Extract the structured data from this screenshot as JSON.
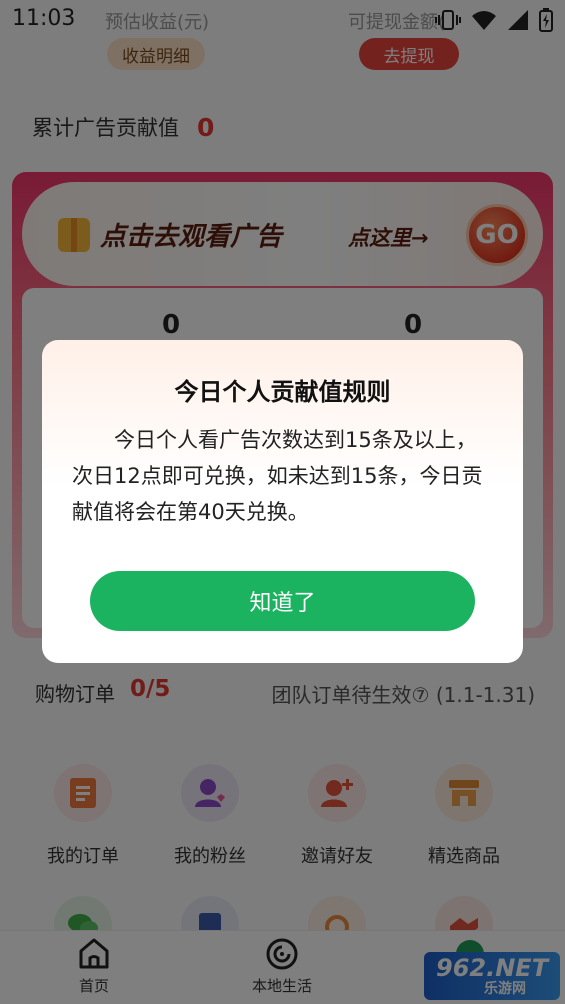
{
  "status_bar": {
    "time": "11:03"
  },
  "header": {
    "earnings_label": "预估收益(元)",
    "withdrawable_label": "可提现金额(",
    "detail_button": "收益明细",
    "withdraw_button": "去提现"
  },
  "contribution": {
    "label": "累计广告贡献值",
    "value": "0"
  },
  "ad_banner": {
    "title": "点击去观看广告",
    "hint": "点这里→",
    "go": "GO"
  },
  "stats": {
    "left_value": "0",
    "right_value": "0"
  },
  "orders": {
    "label": "购物订单",
    "count": "0/5",
    "team_text": "团队订单待生效⑦ (1.1-1.31)"
  },
  "grid_row1": [
    {
      "label": "我的订单",
      "icon": "order-icon"
    },
    {
      "label": "我的粉丝",
      "icon": "fans-icon"
    },
    {
      "label": "邀请好友",
      "icon": "invite-icon"
    },
    {
      "label": "精选商品",
      "icon": "store-icon"
    }
  ],
  "tabs": [
    {
      "label": "首页",
      "icon": "home-icon"
    },
    {
      "label": "本地生活",
      "icon": "local-life-icon"
    }
  ],
  "watermark": {
    "brand": "962.NET",
    "sub": "乐游网"
  },
  "modal": {
    "title": "今日个人贡献值规则",
    "body": "今日个人看广告次数达到15条及以上，次日12点即可兑换，如未达到15条，今日贡献值将会在第40天兑换。",
    "confirm": "知道了"
  },
  "colors": {
    "accent_red": "#e53935",
    "confirm_green": "#1bb35f",
    "withdraw_red": "#e8453c"
  }
}
